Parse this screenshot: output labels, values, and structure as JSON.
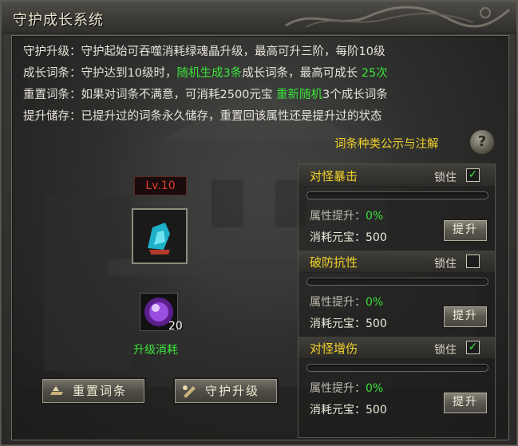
{
  "window": {
    "title": "守护成长系统"
  },
  "description": [
    {
      "label": "守护升级：",
      "parts": [
        {
          "text": "守护起始可吞噬消耗绿魂晶升级，最高可升三阶，每阶10级",
          "color": "white"
        }
      ]
    },
    {
      "label": "成长词条：",
      "parts": [
        {
          "text": "守护达到10级时，",
          "color": "white"
        },
        {
          "text": "随机生成3条",
          "color": "green"
        },
        {
          "text": "成长词条，最高可成长",
          "color": "white"
        },
        {
          "text": " 25次",
          "color": "green"
        }
      ]
    },
    {
      "label": "重置词条：",
      "parts": [
        {
          "text": "如果对词条不满意，可消耗2500元宝 ",
          "color": "white"
        },
        {
          "text": "重新随机",
          "color": "green"
        },
        {
          "text": "3个成长词条",
          "color": "white"
        }
      ]
    },
    {
      "label": "提升储存：",
      "parts": [
        {
          "text": "已提升过的词条永久储存，重置回该属性还是提升过的状态",
          "color": "white"
        }
      ]
    }
  ],
  "legend_link": "词条种类公示与注解",
  "help_icon": "?",
  "guardian": {
    "level": "Lv.10"
  },
  "material": {
    "count": "20",
    "label": "升级消耗"
  },
  "buttons": {
    "reset": "重置词条",
    "upgrade": "守护升级"
  },
  "attributes": [
    {
      "name": "对怪暴击",
      "lock_label": "锁住",
      "locked": true,
      "boost_label": "属性提升：",
      "boost_value": "0%",
      "cost_label": "消耗元宝：",
      "cost_value": "500",
      "button": "提升",
      "progress": 0
    },
    {
      "name": "破防抗性",
      "lock_label": "锁住",
      "locked": false,
      "boost_label": "属性提升：",
      "boost_value": "0%",
      "cost_label": "消耗元宝：",
      "cost_value": "500",
      "button": "提升",
      "progress": 0
    },
    {
      "name": "对怪增伤",
      "lock_label": "锁住",
      "locked": true,
      "boost_label": "属性提升：",
      "boost_value": "0%",
      "cost_label": "消耗元宝：",
      "cost_value": "500",
      "button": "提升",
      "progress": 0
    }
  ],
  "colors": {
    "green": "#3be23b",
    "gold": "#f2d22a",
    "red": "#e23b2f"
  }
}
